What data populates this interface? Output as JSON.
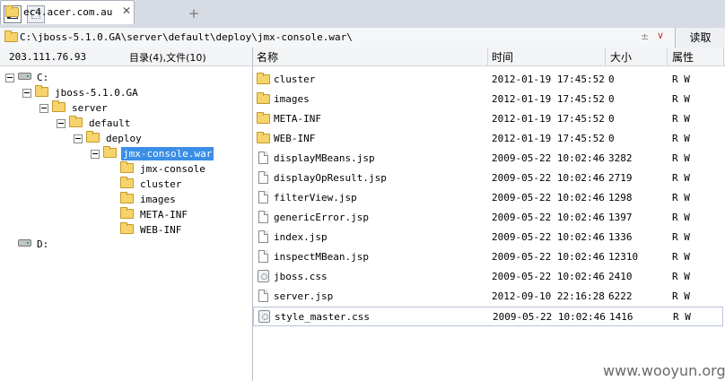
{
  "tabs": [
    {
      "title": "ec4.acer.com.au"
    }
  ],
  "address": {
    "path": "C:\\jboss-5.1.0.GA\\server\\default\\deploy\\jmx-console.war\\",
    "sort_glyph": "±",
    "dropdown_glyph": "∨",
    "read_button": "读取"
  },
  "tree": {
    "host": "203.111.76.93",
    "summary": "目录(4),文件(10)",
    "nodes": [
      {
        "label": "C:",
        "icon": "drive-icon"
      },
      {
        "label": "jboss-5.1.0.GA",
        "icon": "folder-icon"
      },
      {
        "label": "server",
        "icon": "folder-icon"
      },
      {
        "label": "default",
        "icon": "folder-icon"
      },
      {
        "label": "deploy",
        "icon": "folder-icon"
      },
      {
        "label": "jmx-console.war",
        "icon": "folder-icon",
        "selected": true
      },
      {
        "label": "jmx-console",
        "icon": "folder-icon"
      },
      {
        "label": "cluster",
        "icon": "folder-icon"
      },
      {
        "label": "images",
        "icon": "folder-icon"
      },
      {
        "label": "META-INF",
        "icon": "folder-icon"
      },
      {
        "label": "WEB-INF",
        "icon": "folder-icon"
      },
      {
        "label": "D:",
        "icon": "drive-icon"
      }
    ]
  },
  "list": {
    "columns": {
      "name": "名称",
      "time": "时间",
      "size": "大小",
      "attr": "属性"
    },
    "rows": [
      {
        "name": "cluster",
        "time": "2012-01-19 17:45:52",
        "size": "0",
        "attr": "R W",
        "icon": "folder-icon"
      },
      {
        "name": "images",
        "time": "2012-01-19 17:45:52",
        "size": "0",
        "attr": "R W",
        "icon": "folder-icon"
      },
      {
        "name": "META-INF",
        "time": "2012-01-19 17:45:52",
        "size": "0",
        "attr": "R W",
        "icon": "folder-icon"
      },
      {
        "name": "WEB-INF",
        "time": "2012-01-19 17:45:52",
        "size": "0",
        "attr": "R W",
        "icon": "folder-icon"
      },
      {
        "name": "displayMBeans.jsp",
        "time": "2009-05-22 10:02:46",
        "size": "3282",
        "attr": "R W",
        "icon": "file-icon"
      },
      {
        "name": "displayOpResult.jsp",
        "time": "2009-05-22 10:02:46",
        "size": "2719",
        "attr": "R W",
        "icon": "file-icon"
      },
      {
        "name": "filterView.jsp",
        "time": "2009-05-22 10:02:46",
        "size": "1298",
        "attr": "R W",
        "icon": "file-icon"
      },
      {
        "name": "genericError.jsp",
        "time": "2009-05-22 10:02:46",
        "size": "1397",
        "attr": "R W",
        "icon": "file-icon"
      },
      {
        "name": "index.jsp",
        "time": "2009-05-22 10:02:46",
        "size": "1336",
        "attr": "R W",
        "icon": "file-icon"
      },
      {
        "name": "inspectMBean.jsp",
        "time": "2009-05-22 10:02:46",
        "size": "12310",
        "attr": "R W",
        "icon": "file-icon"
      },
      {
        "name": "jboss.css",
        "time": "2009-05-22 10:02:46",
        "size": "2410",
        "attr": "R W",
        "icon": "css-file-icon"
      },
      {
        "name": "server.jsp",
        "time": "2012-09-10 22:16:28",
        "size": "6222",
        "attr": "R W",
        "icon": "file-icon"
      },
      {
        "name": "style_master.css",
        "time": "2009-05-22 10:02:46",
        "size": "1416",
        "attr": "R W",
        "icon": "css-file-icon",
        "selected": true
      }
    ]
  },
  "watermark": "www.wooyun.org"
}
